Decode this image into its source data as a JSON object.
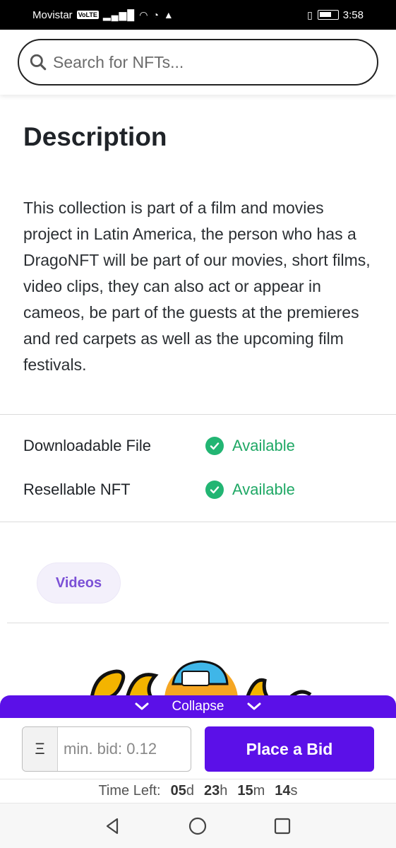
{
  "status_bar": {
    "carrier": "Movistar",
    "volte": "VoLTE",
    "time": "3:58"
  },
  "search": {
    "placeholder": "Search for NFTs..."
  },
  "description": {
    "title": "Description",
    "text": "This collection is part of a film and movies project in Latin America, the person who has a DragoNFT will be part of our movies, short films, video clips, they can also act or appear in cameos, be part of the guests at the premieres and red carpets as well as the upcoming film festivals."
  },
  "properties": [
    {
      "label": "Downloadable File",
      "value": "Available"
    },
    {
      "label": "Resellable NFT",
      "value": "Available"
    }
  ],
  "tag": {
    "label": "Videos"
  },
  "bid_panel": {
    "collapse_label": "Collapse",
    "currency_symbol": "Ξ",
    "bid_placeholder": "min. bid: 0.12",
    "place_bid_label": "Place a Bid",
    "time_left_label": "Time Left:",
    "days": "05",
    "days_unit": "d",
    "hours": "23",
    "hours_unit": "h",
    "minutes": "15",
    "minutes_unit": "m",
    "seconds": "14",
    "seconds_unit": "s"
  },
  "colors": {
    "accent": "#5b10e8",
    "available_green": "#1fa865",
    "tag_text": "#7b50d6"
  },
  "icons": [
    "search-icon",
    "check-circle-icon",
    "chevron-down-icon",
    "back-nav-icon",
    "home-nav-icon",
    "recents-nav-icon",
    "wifi-icon",
    "signal-icon",
    "battery-icon"
  ]
}
